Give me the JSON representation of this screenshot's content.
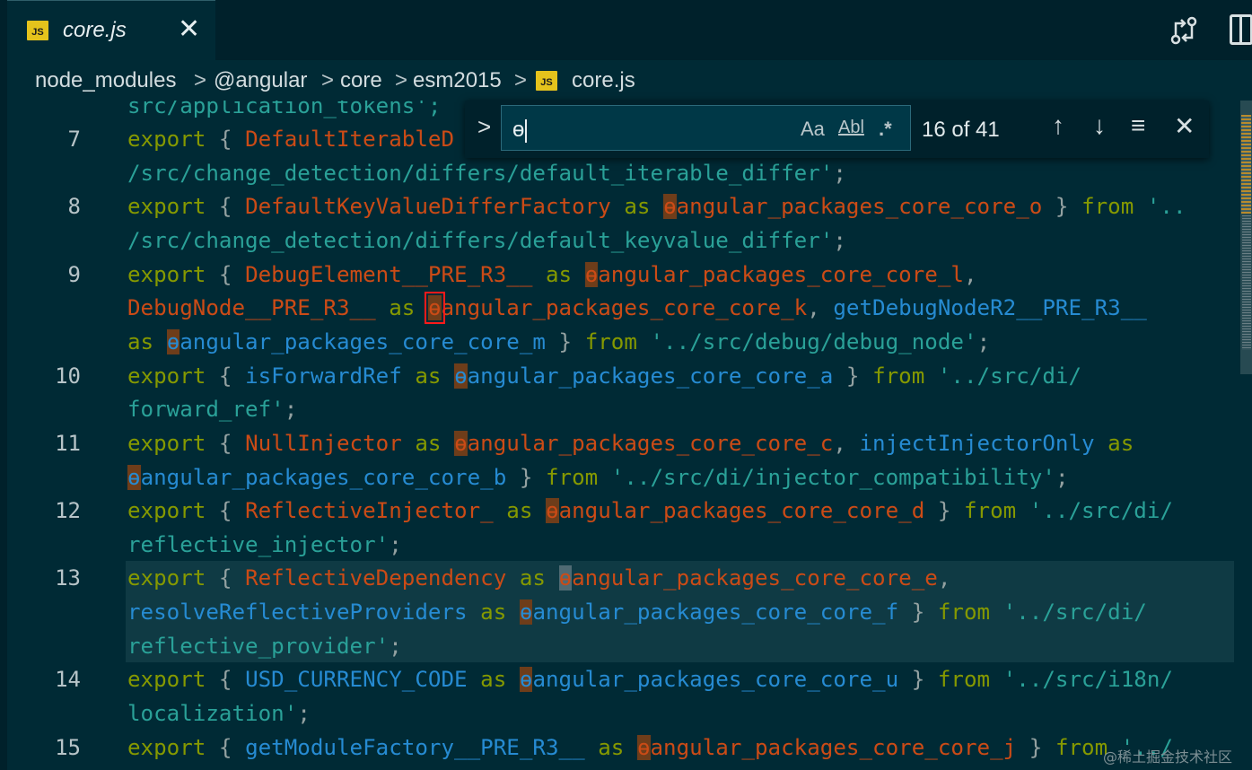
{
  "colors": {
    "keyword": "#859900",
    "identifier_orange": "#cb4b16",
    "identifier_blue": "#268bd2",
    "string": "#2aa198",
    "match_highlight": "#6e3d1a",
    "background": "#002a35"
  },
  "tab": {
    "icon": "js-file-icon",
    "badge": "JS",
    "title": "core.js",
    "close": "✕"
  },
  "actions": {
    "compare": "source-compare-icon",
    "split": "split-editor-icon"
  },
  "breadcrumb": {
    "items": [
      "node_modules",
      "@angular",
      "core",
      "esm2015"
    ],
    "separator": ">",
    "file_badge": "JS",
    "file": "core.js"
  },
  "find": {
    "toggle": ">",
    "value": "ɵ",
    "match_case": "Aa",
    "whole_word": "Abl",
    "regex": ".*",
    "count": "16 of 41",
    "prev": "↑",
    "next": "↓",
    "selection": "≡",
    "close": "✕"
  },
  "editor": {
    "line_numbers": [
      "7",
      "8",
      "9",
      "10",
      "11",
      "12",
      "13",
      "14",
      "15"
    ],
    "partial_top_line": "src/application_tokens';",
    "lines": [
      [
        {
          "t": "export",
          "c": "k"
        },
        {
          "t": " { ",
          "c": "p"
        },
        {
          "t": "DefaultIterableD",
          "c": "o"
        }
      ],
      [
        {
          "t": "/src/change_detection/differs/default_iterable_differ'",
          "c": "s"
        },
        {
          "t": ";",
          "c": "p"
        }
      ],
      [
        {
          "t": "export",
          "c": "k"
        },
        {
          "t": " { ",
          "c": "p"
        },
        {
          "t": "DefaultKeyValueDifferFactory",
          "c": "o"
        },
        {
          "t": " as ",
          "c": "k"
        },
        {
          "t": "ɵ",
          "c": "o",
          "m": 1
        },
        {
          "t": "angular_packages_core_core_o",
          "c": "o"
        },
        {
          "t": " } ",
          "c": "p"
        },
        {
          "t": "from",
          "c": "k"
        },
        {
          "t": " '..",
          "c": "s"
        }
      ],
      [
        {
          "t": "/src/change_detection/differs/default_keyvalue_differ'",
          "c": "s"
        },
        {
          "t": ";",
          "c": "p"
        }
      ],
      [
        {
          "t": "export",
          "c": "k"
        },
        {
          "t": " { ",
          "c": "p"
        },
        {
          "t": "DebugElement__PRE_R3__",
          "c": "o"
        },
        {
          "t": " as ",
          "c": "k"
        },
        {
          "t": "ɵ",
          "c": "o",
          "m": 1
        },
        {
          "t": "angular_packages_core_core_l",
          "c": "o"
        },
        {
          "t": ",",
          "c": "p"
        }
      ],
      [
        {
          "t": "DebugNode__PRE_R3__",
          "c": "o"
        },
        {
          "t": " as ",
          "c": "k"
        },
        {
          "t": "ɵ",
          "c": "o",
          "m": 1,
          "sel": 1
        },
        {
          "t": "angular_packages_core_core_k",
          "c": "o"
        },
        {
          "t": ", ",
          "c": "p"
        },
        {
          "t": "getDebugNodeR2__PRE_R3__",
          "c": "b"
        }
      ],
      [
        {
          "t": "as ",
          "c": "k"
        },
        {
          "t": "ɵ",
          "c": "b",
          "m": 1
        },
        {
          "t": "angular_packages_core_core_m",
          "c": "b"
        },
        {
          "t": " } ",
          "c": "p"
        },
        {
          "t": "from",
          "c": "k"
        },
        {
          "t": " '../src/debug/debug_node'",
          "c": "s"
        },
        {
          "t": ";",
          "c": "p"
        }
      ],
      [
        {
          "t": "export",
          "c": "k"
        },
        {
          "t": " { ",
          "c": "p"
        },
        {
          "t": "isForwardRef",
          "c": "b"
        },
        {
          "t": " as ",
          "c": "k"
        },
        {
          "t": "ɵ",
          "c": "b",
          "m": 1
        },
        {
          "t": "angular_packages_core_core_a",
          "c": "b"
        },
        {
          "t": " } ",
          "c": "p"
        },
        {
          "t": "from",
          "c": "k"
        },
        {
          "t": " '../src/di/",
          "c": "s"
        }
      ],
      [
        {
          "t": "forward_ref'",
          "c": "s"
        },
        {
          "t": ";",
          "c": "p"
        }
      ],
      [
        {
          "t": "export",
          "c": "k"
        },
        {
          "t": " { ",
          "c": "p"
        },
        {
          "t": "NullInjector",
          "c": "o"
        },
        {
          "t": " as ",
          "c": "k"
        },
        {
          "t": "ɵ",
          "c": "o",
          "m": 1
        },
        {
          "t": "angular_packages_core_core_c",
          "c": "o"
        },
        {
          "t": ", ",
          "c": "p"
        },
        {
          "t": "injectInjectorOnly",
          "c": "b"
        },
        {
          "t": " as",
          "c": "k"
        }
      ],
      [
        {
          "t": "ɵ",
          "c": "b",
          "m": 1
        },
        {
          "t": "angular_packages_core_core_b",
          "c": "b"
        },
        {
          "t": " } ",
          "c": "p"
        },
        {
          "t": "from",
          "c": "k"
        },
        {
          "t": " '../src/di/injector_compatibility'",
          "c": "s"
        },
        {
          "t": ";",
          "c": "p"
        }
      ],
      [
        {
          "t": "export",
          "c": "k"
        },
        {
          "t": " { ",
          "c": "p"
        },
        {
          "t": "ReflectiveInjector_",
          "c": "o"
        },
        {
          "t": " as ",
          "c": "k"
        },
        {
          "t": "ɵ",
          "c": "o",
          "m": 1
        },
        {
          "t": "angular_packages_core_core_d",
          "c": "o"
        },
        {
          "t": " } ",
          "c": "p"
        },
        {
          "t": "from",
          "c": "k"
        },
        {
          "t": " '../src/di/",
          "c": "s"
        }
      ],
      [
        {
          "t": "reflective_injector'",
          "c": "s"
        },
        {
          "t": ";",
          "c": "p"
        }
      ],
      [
        {
          "t": "export",
          "c": "k"
        },
        {
          "t": " { ",
          "c": "p"
        },
        {
          "t": "ReflectiveDependency",
          "c": "o"
        },
        {
          "t": " as ",
          "c": "k"
        },
        {
          "t": "ɵ",
          "c": "o",
          "m": 2
        },
        {
          "t": "angular_packages_core_core_e",
          "c": "o"
        },
        {
          "t": ",",
          "c": "p"
        }
      ],
      [
        {
          "t": "resolveReflectiveProviders",
          "c": "b"
        },
        {
          "t": " as ",
          "c": "k"
        },
        {
          "t": "ɵ",
          "c": "b",
          "m": 1
        },
        {
          "t": "angular_packages_core_core_f",
          "c": "b"
        },
        {
          "t": " } ",
          "c": "p"
        },
        {
          "t": "from",
          "c": "k"
        },
        {
          "t": " '../src/di/",
          "c": "s"
        }
      ],
      [
        {
          "t": "reflective_provider'",
          "c": "s"
        },
        {
          "t": ";",
          "c": "p"
        }
      ],
      [
        {
          "t": "export",
          "c": "k"
        },
        {
          "t": " { ",
          "c": "p"
        },
        {
          "t": "USD_CURRENCY_CODE",
          "c": "b"
        },
        {
          "t": " as ",
          "c": "k"
        },
        {
          "t": "ɵ",
          "c": "b",
          "m": 1
        },
        {
          "t": "angular_packages_core_core_u",
          "c": "b"
        },
        {
          "t": " } ",
          "c": "p"
        },
        {
          "t": "from",
          "c": "k"
        },
        {
          "t": " '../src/i18n/",
          "c": "s"
        }
      ],
      [
        {
          "t": "localization'",
          "c": "s"
        },
        {
          "t": ";",
          "c": "p"
        }
      ],
      [
        {
          "t": "export",
          "c": "k"
        },
        {
          "t": " { ",
          "c": "p"
        },
        {
          "t": "getModuleFactory__PRE_R3__",
          "c": "b"
        },
        {
          "t": " as ",
          "c": "k"
        },
        {
          "t": "ɵ",
          "c": "o",
          "m": 1
        },
        {
          "t": "angular_packages_core_core_j",
          "c": "o"
        },
        {
          "t": " } ",
          "c": "p"
        },
        {
          "t": "from",
          "c": "k"
        },
        {
          "t": " '../",
          "c": "s"
        }
      ]
    ]
  },
  "watermark": "@稀土掘金技术社区"
}
